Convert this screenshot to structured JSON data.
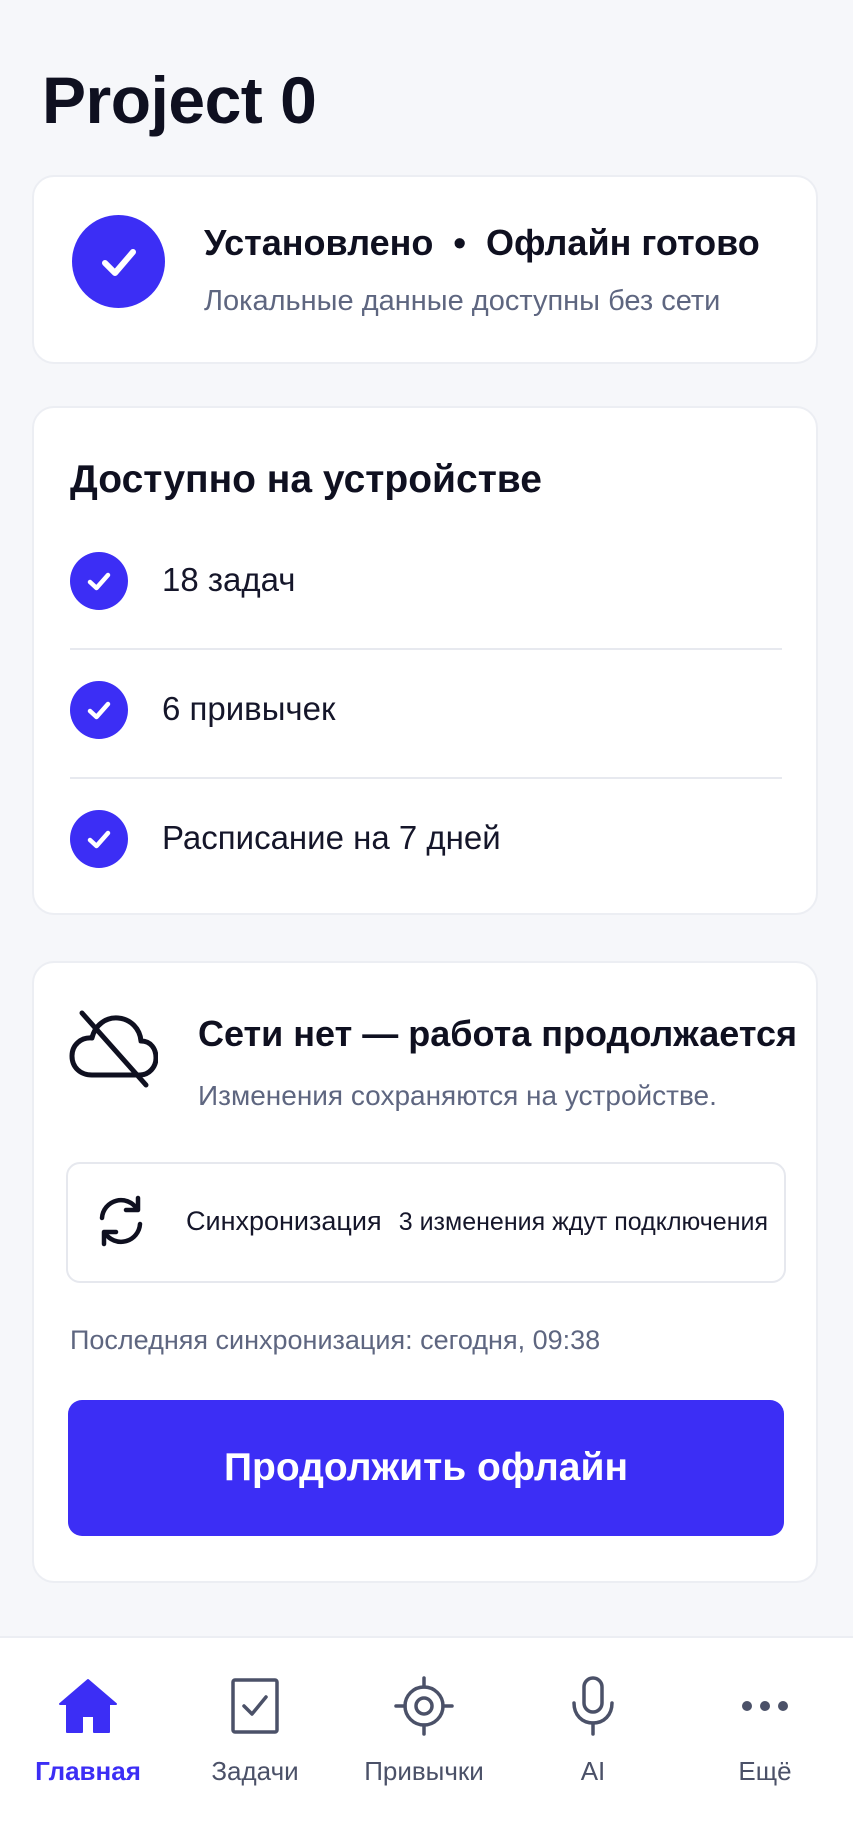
{
  "colors": {
    "accent": "#3c2ef5",
    "text_primary": "#0f1020",
    "text_secondary": "#5e6680",
    "background": "#f6f7fa",
    "card": "#ffffff"
  },
  "header": {
    "title": "Project 0"
  },
  "status_card": {
    "icon": "check-circle-icon",
    "title": "Установлено  •  Офлайн готово",
    "subtitle": "Локальные данные доступны без сети"
  },
  "available": {
    "title": "Доступно на устройстве",
    "items": [
      {
        "icon": "check-circle-icon",
        "label": "18 задач"
      },
      {
        "icon": "check-circle-icon",
        "label": "6 привычек"
      },
      {
        "icon": "check-circle-icon",
        "label": "Расписание на 7 дней"
      }
    ]
  },
  "offline": {
    "icon": "cloud-off-icon",
    "title": "Сети нет — работа продолжается",
    "subtitle": "Изменения сохраняются на устройстве.",
    "sync": {
      "icon": "sync-icon",
      "label": "Синхронизация",
      "pending": "3 изменения ждут подключения"
    },
    "last_sync": "Последняя синхронизация: сегодня, 09:38",
    "button_label": "Продолжить офлайн"
  },
  "nav": {
    "items": [
      {
        "icon": "home-icon",
        "label": "Главная",
        "active": true
      },
      {
        "icon": "task-checkbox-icon",
        "label": "Задачи",
        "active": false
      },
      {
        "icon": "target-icon",
        "label": "Привычки",
        "active": false
      },
      {
        "icon": "microphone-icon",
        "label": "AI",
        "active": false
      },
      {
        "icon": "more-dots-icon",
        "label": "Ещё",
        "active": false
      }
    ]
  }
}
